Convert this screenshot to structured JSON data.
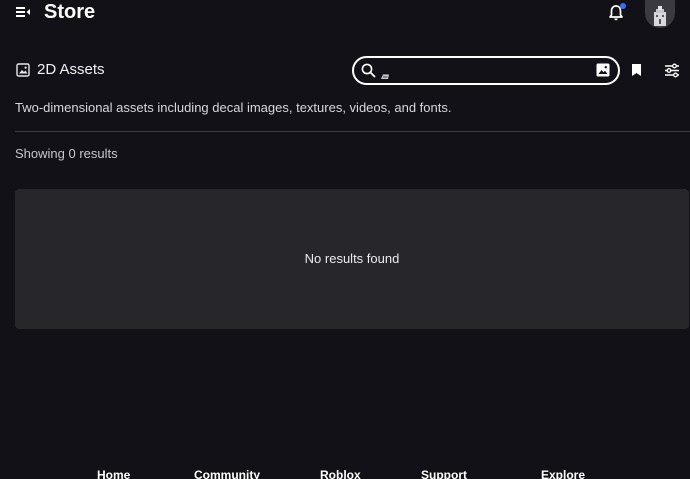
{
  "header": {
    "title": "Store",
    "menu_icon": "menu-collapse-icon",
    "notification_icon": "bell-icon",
    "notification_badge_color": "#3b6df6"
  },
  "category": {
    "icon": "image-icon",
    "title": "2D Assets",
    "description": "Two-dimensional assets including decal images, textures, videos, and fonts."
  },
  "search": {
    "value": "",
    "placeholder": "",
    "image_search_icon": "image-search-icon"
  },
  "toolbar": {
    "bookmark_icon": "bookmark-icon",
    "filter_icon": "filters-icon"
  },
  "results": {
    "count_label": "Showing 0 results",
    "empty_message": "No results found"
  },
  "footer": {
    "links": [
      "Home",
      "Community",
      "Roblox",
      "Support",
      "Explore"
    ]
  },
  "colors": {
    "background": "#121117",
    "panel": "#26262b",
    "accent": "#3b6df6"
  }
}
